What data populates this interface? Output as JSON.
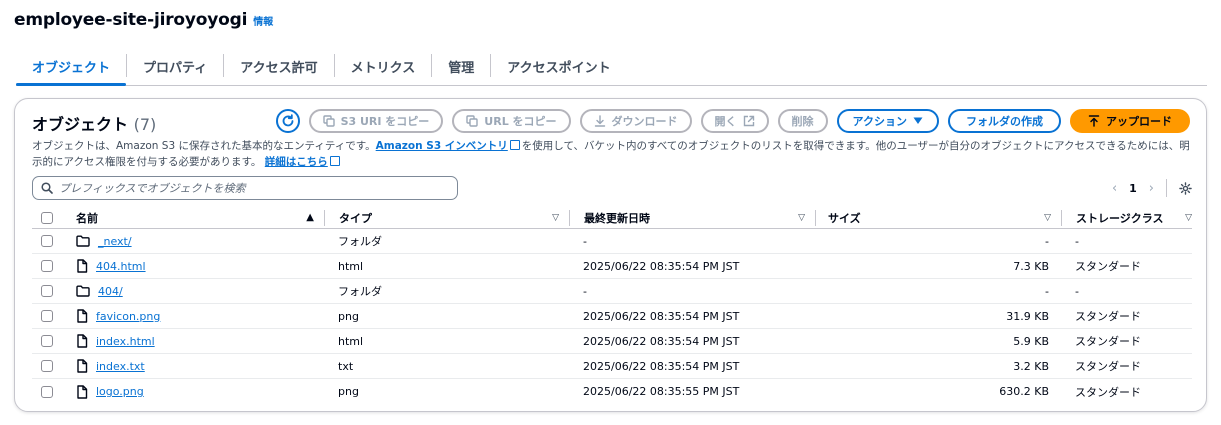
{
  "header": {
    "title": "employee-site-jiroyoyogi",
    "info": "情報"
  },
  "tabs": [
    "オブジェクト",
    "プロパティ",
    "アクセス許可",
    "メトリクス",
    "管理",
    "アクセスポイント"
  ],
  "panel": {
    "title": "オブジェクト",
    "count": "(7)",
    "buttons": {
      "copy_s3_uri": "S3 URI をコピー",
      "copy_url": "URL をコピー",
      "download": "ダウンロード",
      "open": "開く",
      "delete": "削除",
      "actions": "アクション",
      "create_folder": "フォルダの作成",
      "upload": "アップロード"
    },
    "description": {
      "part1": "オブジェクトは、Amazon S3 に保存された基本的なエンティティです。",
      "link1": "Amazon S3 インベントリ",
      "part2": "を使用して、バケット内のすべてのオブジェクトのリストを取得できます。他のユーザーが自分のオブジェクトにアクセスできるためには、明示的にアクセス権限を付与する必要があります。",
      "link2": "詳細はこちら"
    },
    "search": {
      "placeholder": "プレフィックスでオブジェクトを検索"
    },
    "pager": {
      "page": "1"
    }
  },
  "table": {
    "columns": {
      "name": "名前",
      "type": "タイプ",
      "modified": "最終更新日時",
      "size": "サイズ",
      "storage": "ストレージクラス"
    },
    "rows": [
      {
        "name": "_next/",
        "kind": "folder",
        "type": "フォルダ",
        "modified": "-",
        "size": "-",
        "storage": "-"
      },
      {
        "name": "404.html",
        "kind": "file",
        "type": "html",
        "modified": "2025/06/22 08:35:54 PM JST",
        "size": "7.3 KB",
        "storage": "スタンダード"
      },
      {
        "name": "404/",
        "kind": "folder",
        "type": "フォルダ",
        "modified": "-",
        "size": "-",
        "storage": "-"
      },
      {
        "name": "favicon.png",
        "kind": "file",
        "type": "png",
        "modified": "2025/06/22 08:35:54 PM JST",
        "size": "31.9 KB",
        "storage": "スタンダード"
      },
      {
        "name": "index.html",
        "kind": "file",
        "type": "html",
        "modified": "2025/06/22 08:35:54 PM JST",
        "size": "5.9 KB",
        "storage": "スタンダード"
      },
      {
        "name": "index.txt",
        "kind": "file",
        "type": "txt",
        "modified": "2025/06/22 08:35:54 PM JST",
        "size": "3.2 KB",
        "storage": "スタンダード"
      },
      {
        "name": "logo.png",
        "kind": "file",
        "type": "png",
        "modified": "2025/06/22 08:35:55 PM JST",
        "size": "630.2 KB",
        "storage": "スタンダード"
      }
    ]
  },
  "colors": {
    "accent": "#0972d3",
    "upload": "#ff9900",
    "text": "#000716",
    "disabled": "#9ba7b6"
  }
}
